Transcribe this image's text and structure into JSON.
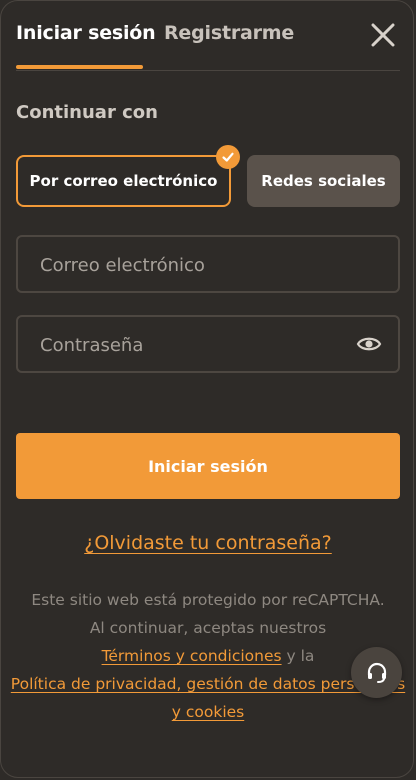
{
  "tabs": {
    "login": "Iniciar sesión",
    "register": "Registrarme"
  },
  "continue_with": "Continuar con",
  "options": {
    "email": "Por correo electrónico",
    "social": "Redes sociales"
  },
  "fields": {
    "email_placeholder": "Correo electrónico",
    "password_placeholder": "Contraseña"
  },
  "submit_label": "Iniciar sesión",
  "forgot_password": "¿Olvidaste tu contraseña?",
  "legal": {
    "line1": "Este sitio web está protegido por reCAPTCHA.",
    "line2": "Al continuar, aceptas nuestros",
    "terms_link": "Términos y condiciones",
    "and_text": "y la",
    "privacy_link": "Política de privacidad, gestión de datos personales y cookies"
  },
  "colors": {
    "accent": "#f29a38",
    "background": "#2e2b28"
  },
  "icons": {
    "close": "close-icon",
    "check": "check-icon",
    "eye": "eye-icon",
    "support": "headset-icon"
  }
}
